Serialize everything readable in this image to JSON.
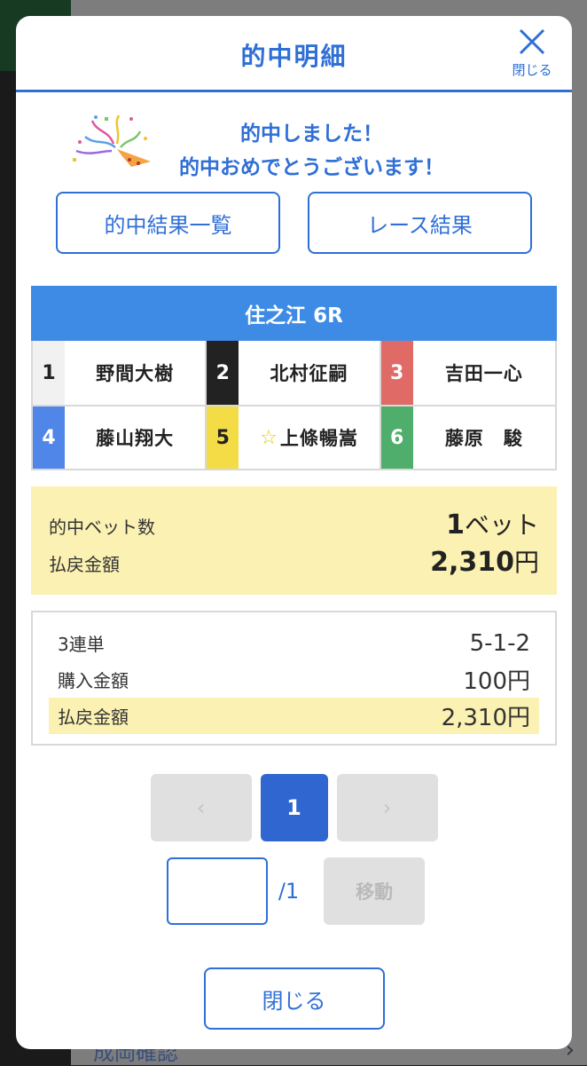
{
  "background": {
    "bottom_text": "成岡確認"
  },
  "modal": {
    "title": "的中明細",
    "close_label": "閉じる"
  },
  "congrats": {
    "line1": "的中しました！",
    "line2": "的中おめでとうございます！"
  },
  "buttons": {
    "hit_results": "的中結果一覧",
    "race_results": "レース結果"
  },
  "race": {
    "title": "住之江 6R",
    "racers": [
      {
        "num": "1",
        "name": "野間大樹",
        "bg": "#f1f1f1",
        "fg": "#222222",
        "star": false
      },
      {
        "num": "2",
        "name": "北村征嗣",
        "bg": "#222222",
        "fg": "#ffffff",
        "star": false
      },
      {
        "num": "3",
        "name": "吉田一心",
        "bg": "#e06b66",
        "fg": "#ffffff",
        "star": false
      },
      {
        "num": "4",
        "name": "藤山翔大",
        "bg": "#4f86e8",
        "fg": "#ffffff",
        "star": false
      },
      {
        "num": "5",
        "name": "上條暢嵩",
        "bg": "#f4dc47",
        "fg": "#222222",
        "star": true
      },
      {
        "num": "6",
        "name": "藤原　駿",
        "bg": "#4fae6b",
        "fg": "#ffffff",
        "star": false
      }
    ],
    "star_icon": "☆"
  },
  "summary": {
    "bets_label": "的中ベット数",
    "bets_value": "1",
    "bets_unit": "ベット",
    "payout_label": "払戻金額",
    "payout_value": "2,310",
    "payout_unit": "円"
  },
  "detail": {
    "type_label": "3連単",
    "type_value": "5-1-2",
    "purchase_label": "購入金額",
    "purchase_value": "100円",
    "payout_label": "払戻金額",
    "payout_value": "2,310円"
  },
  "pager": {
    "prev": "‹",
    "current": "1",
    "next": "›",
    "total": "/1",
    "jump_label": "移動"
  },
  "footer": {
    "close_label": "閉じる"
  }
}
